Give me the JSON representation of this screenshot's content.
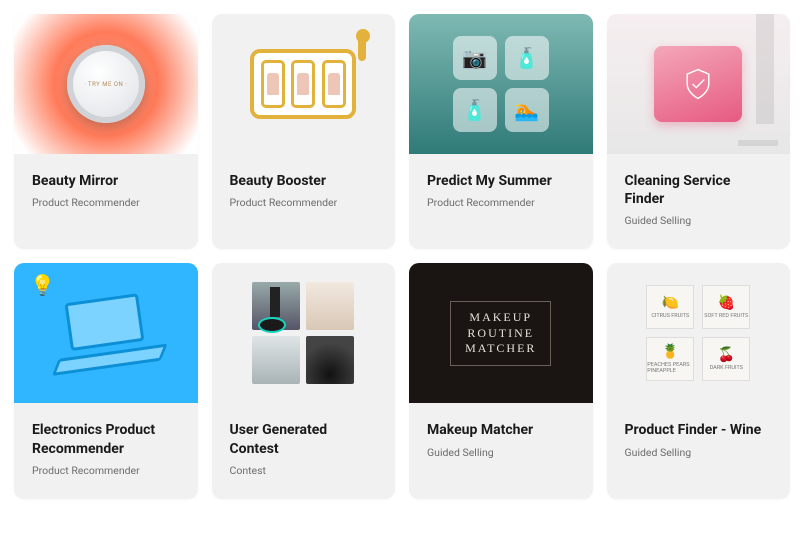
{
  "cards": [
    {
      "title": "Beauty Mirror",
      "category": "Product Recommender"
    },
    {
      "title": "Beauty Booster",
      "category": "Product Recommender"
    },
    {
      "title": "Predict My Summer",
      "category": "Product Recommender"
    },
    {
      "title": "Cleaning Service Finder",
      "category": "Guided Selling"
    },
    {
      "title": "Electronics Product Recommender",
      "category": "Product Recommender"
    },
    {
      "title": "User Generated Contest",
      "category": "Contest"
    },
    {
      "title": "Makeup Matcher",
      "category": "Guided Selling"
    },
    {
      "title": "Product Finder - Wine",
      "category": "Guided Selling"
    }
  ],
  "thumb_text": {
    "makeup_l1": "MAKEUP",
    "makeup_l2": "ROUTINE",
    "makeup_l3": "MATCHER",
    "wine_notes": [
      "CITRUS FRUITS",
      "SOFT RED FRUITS",
      "PEACHES PEARS PINEAPPLE",
      "DARK FRUITS"
    ],
    "mirror_label": "· TRY ME ON ·"
  }
}
